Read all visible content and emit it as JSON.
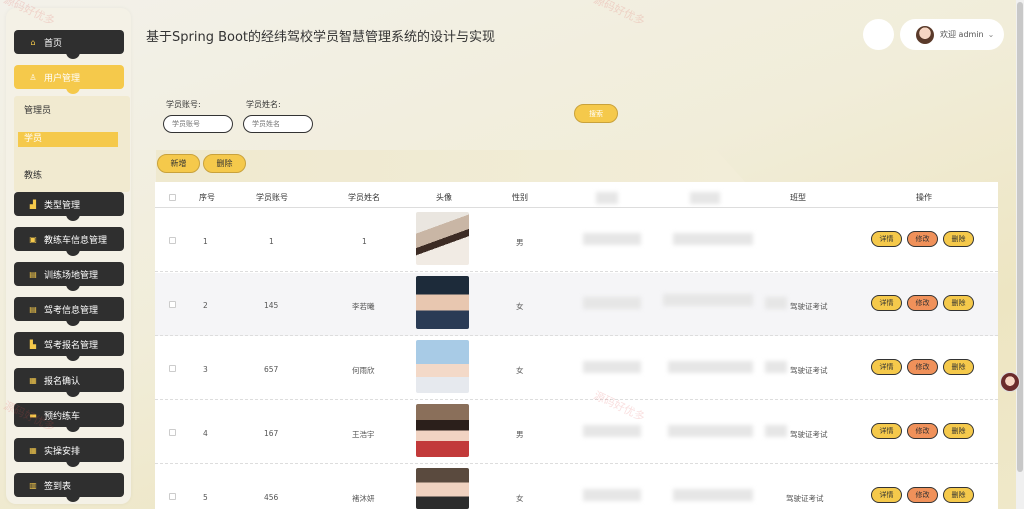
{
  "header": {
    "title": "基于Spring Boot的经纬驾校学员智慧管理系统的设计与实现",
    "welcome": "欢迎 admin"
  },
  "sidebar": {
    "items": [
      {
        "label": "首页",
        "icon": "home-icon"
      },
      {
        "label": "用户管理",
        "icon": "user-icon"
      },
      {
        "label": "类型管理",
        "icon": "type-icon"
      },
      {
        "label": "教练车信息管理",
        "icon": "car-icon"
      },
      {
        "label": "训练场地管理",
        "icon": "field-icon"
      },
      {
        "label": "驾考信息管理",
        "icon": "exam-icon"
      },
      {
        "label": "驾考报名管理",
        "icon": "signup-icon"
      },
      {
        "label": "报名确认",
        "icon": "confirm-icon"
      },
      {
        "label": "预约练车",
        "icon": "booking-icon"
      },
      {
        "label": "实操安排",
        "icon": "schedule-icon"
      },
      {
        "label": "签到表",
        "icon": "checkin-icon"
      }
    ],
    "submenu": [
      "管理员",
      "学员",
      "教练"
    ]
  },
  "search": {
    "account_label": "学员账号:",
    "account_placeholder": "学员账号",
    "name_label": "学员姓名:",
    "name_placeholder": "学员姓名",
    "search_button": "搜索"
  },
  "toolbar": {
    "add": "新增",
    "delete": "删除"
  },
  "table": {
    "headers": {
      "no": "序号",
      "account": "学员账号",
      "name": "学员姓名",
      "avatar": "头像",
      "gender": "性别",
      "class": "班型",
      "ops": "操作"
    },
    "rows": [
      {
        "no": "1",
        "account": "1",
        "name": "1",
        "gender": "男",
        "class": ""
      },
      {
        "no": "2",
        "account": "145",
        "name": "李若曦",
        "gender": "女",
        "class": "驾驶证考试"
      },
      {
        "no": "3",
        "account": "657",
        "name": "何雨欣",
        "gender": "女",
        "class": "驾驶证考试"
      },
      {
        "no": "4",
        "account": "167",
        "name": "王浩宇",
        "gender": "男",
        "class": "驾驶证考试"
      },
      {
        "no": "5",
        "account": "456",
        "name": "褚沐妍",
        "gender": "女",
        "class": "驾驶证考试"
      }
    ],
    "actions": {
      "detail": "详情",
      "edit": "修改",
      "delete": "删除"
    }
  },
  "watermark": "源码好优多"
}
